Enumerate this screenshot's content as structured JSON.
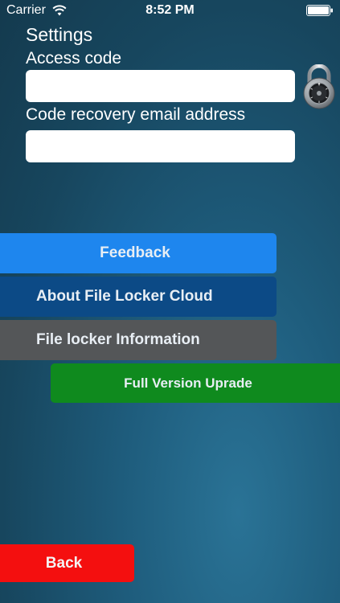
{
  "status_bar": {
    "carrier": "Carrier",
    "time": "8:52 PM",
    "wifi_icon": "wifi-icon",
    "battery_icon": "battery-icon"
  },
  "settings": {
    "title": "Settings",
    "access_code": {
      "label": "Access code",
      "value": "",
      "icon": "padlock-icon"
    },
    "recovery_email": {
      "label": "Code recovery email address",
      "value": ""
    }
  },
  "buttons": {
    "feedback": "Feedback",
    "about": "About File Locker Cloud",
    "info": "File locker Information",
    "upgrade": "Full Version Uprade",
    "back": "Back"
  },
  "colors": {
    "feedback": "#1e86ee",
    "about": "#0c4a86",
    "info": "#545658",
    "upgrade": "#0f8a1e",
    "back": "#f40f0f",
    "background": "#1e5c7c"
  }
}
